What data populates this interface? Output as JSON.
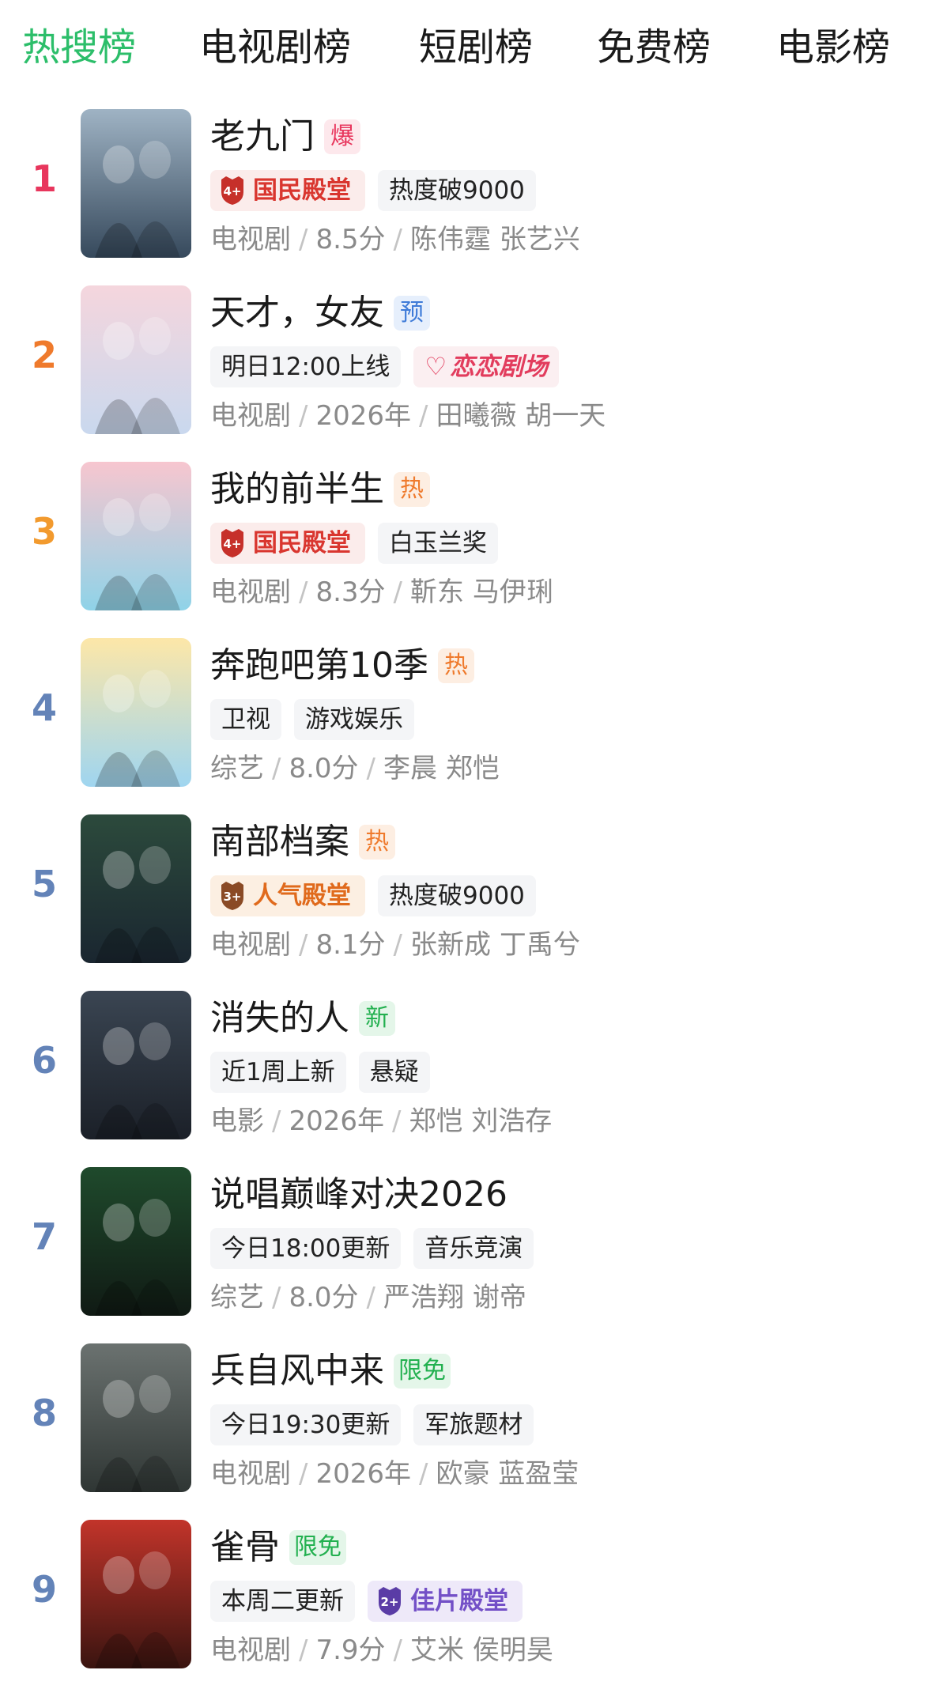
{
  "tabs": [
    "热搜榜",
    "电视剧榜",
    "短剧榜",
    "免费榜",
    "电影榜"
  ],
  "active_tab_index": 0,
  "colors": {
    "active_tab": "#2cbe6a",
    "rank_top": [
      "#e8365d",
      "#ef7a2c",
      "#f29a2e"
    ],
    "rank_other": "#6383b8",
    "badge_bao": "#e8365d",
    "badge_yu": "#3e7bd8",
    "badge_re": "#ef7a2c",
    "badge_xin": "#22b04f",
    "badge_xianmian": "#22b04f"
  },
  "items": [
    {
      "rank": "1",
      "title": "老九门",
      "badge": "爆",
      "tags": [
        {
          "kind": "hall",
          "icon": "4+",
          "text": "国民殿堂"
        },
        {
          "kind": "plain",
          "text": "热度破9000"
        }
      ],
      "category": "电视剧",
      "score": "8.5分",
      "cast": "陈伟霆 张艺兴",
      "poster_icon": "poster-image"
    },
    {
      "rank": "2",
      "title": "天才，女友",
      "badge": "预",
      "tags": [
        {
          "kind": "plain",
          "text": "明日12:00上线"
        },
        {
          "kind": "brand",
          "text": "恋恋剧场"
        }
      ],
      "category": "电视剧",
      "score": "2026年",
      "cast": "田曦薇 胡一天",
      "poster_icon": "poster-image"
    },
    {
      "rank": "3",
      "title": "我的前半生",
      "badge": "热",
      "tags": [
        {
          "kind": "hall",
          "icon": "4+",
          "text": "国民殿堂"
        },
        {
          "kind": "plain",
          "text": "白玉兰奖"
        }
      ],
      "category": "电视剧",
      "score": "8.3分",
      "cast": "靳东 马伊琍",
      "poster_icon": "poster-image"
    },
    {
      "rank": "4",
      "title": "奔跑吧第10季",
      "badge": "热",
      "tags": [
        {
          "kind": "plain",
          "text": "卫视"
        },
        {
          "kind": "plain",
          "text": "游戏娱乐"
        }
      ],
      "category": "综艺",
      "score": "8.0分",
      "cast": "李晨 郑恺",
      "poster_icon": "poster-image"
    },
    {
      "rank": "5",
      "title": "南部档案",
      "badge": "热",
      "tags": [
        {
          "kind": "hall2",
          "icon": "3+",
          "text": "人气殿堂"
        },
        {
          "kind": "plain",
          "text": "热度破9000"
        }
      ],
      "category": "电视剧",
      "score": "8.1分",
      "cast": "张新成 丁禹兮",
      "poster_icon": "poster-image"
    },
    {
      "rank": "6",
      "title": "消失的人",
      "badge": "新",
      "tags": [
        {
          "kind": "plain",
          "text": "近1周上新"
        },
        {
          "kind": "plain",
          "text": "悬疑"
        }
      ],
      "category": "电影",
      "score": "2026年",
      "cast": "郑恺 刘浩存",
      "poster_icon": "poster-image"
    },
    {
      "rank": "7",
      "title": "说唱巅峰对决2026",
      "badge": "",
      "tags": [
        {
          "kind": "plain",
          "text": "今日18:00更新"
        },
        {
          "kind": "plain",
          "text": "音乐竞演"
        }
      ],
      "category": "综艺",
      "score": "8.0分",
      "cast": "严浩翔 谢帝",
      "poster_icon": "poster-image"
    },
    {
      "rank": "8",
      "title": "兵自风中来",
      "badge": "限免",
      "tags": [
        {
          "kind": "plain",
          "text": "今日19:30更新"
        },
        {
          "kind": "plain",
          "text": "军旅题材"
        }
      ],
      "category": "电视剧",
      "score": "2026年",
      "cast": "欧豪 蓝盈莹",
      "poster_icon": "poster-image"
    },
    {
      "rank": "9",
      "title": "雀骨",
      "badge": "限免",
      "tags": [
        {
          "kind": "plain",
          "text": "本周二更新"
        },
        {
          "kind": "hall3",
          "icon": "2+",
          "text": "佳片殿堂"
        }
      ],
      "category": "电视剧",
      "score": "7.9分",
      "cast": "艾米 侯明昊",
      "poster_icon": "poster-image"
    }
  ]
}
